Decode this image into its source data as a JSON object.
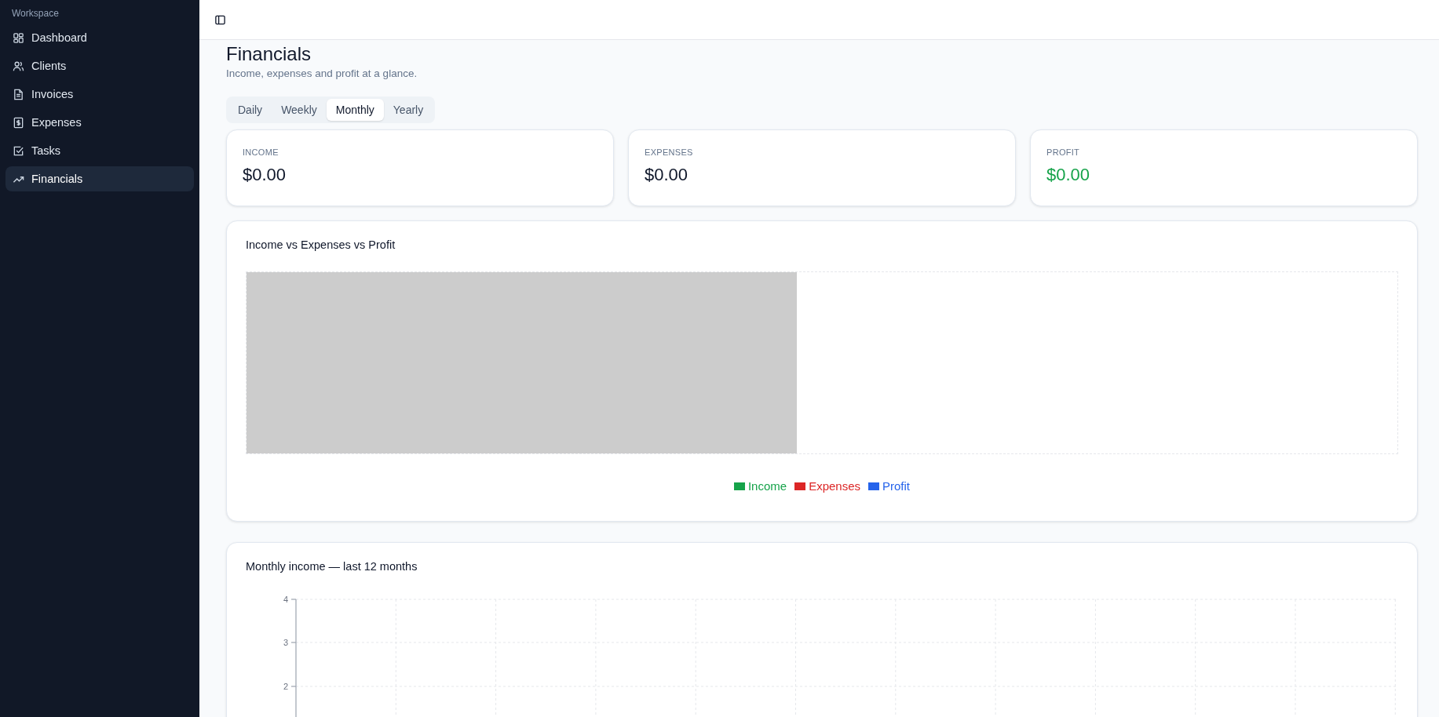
{
  "sidebar": {
    "group_label": "Workspace",
    "items": [
      {
        "label": "Dashboard",
        "selected": false
      },
      {
        "label": "Clients",
        "selected": false
      },
      {
        "label": "Invoices",
        "selected": false
      },
      {
        "label": "Expenses",
        "selected": false
      },
      {
        "label": "Tasks",
        "selected": false
      },
      {
        "label": "Financials",
        "selected": true
      }
    ]
  },
  "page": {
    "title": "Financials",
    "subtitle": "Income, expenses and profit at a glance."
  },
  "period_tabs": [
    {
      "label": "Daily",
      "selected": false
    },
    {
      "label": "Weekly",
      "selected": false
    },
    {
      "label": "Monthly",
      "selected": true
    },
    {
      "label": "Yearly",
      "selected": false
    }
  ],
  "stats": [
    {
      "label": "INCOME",
      "value": "$0.00",
      "kind": "plain"
    },
    {
      "label": "EXPENSES",
      "value": "$0.00",
      "kind": "plain"
    },
    {
      "label": "PROFIT",
      "value": "$0.00",
      "kind": "positive"
    }
  ],
  "comparison_chart": {
    "title": "Income vs Expenses vs Profit",
    "legend": [
      {
        "label": "Income",
        "color": "#16a34a"
      },
      {
        "label": "Expenses",
        "color": "#dc2626"
      },
      {
        "label": "Profit",
        "color": "#2563eb"
      }
    ]
  },
  "monthly_chart": {
    "title": "Monthly income — last 12 months",
    "y_axis_labels": [
      "4",
      "3",
      "2"
    ]
  }
}
